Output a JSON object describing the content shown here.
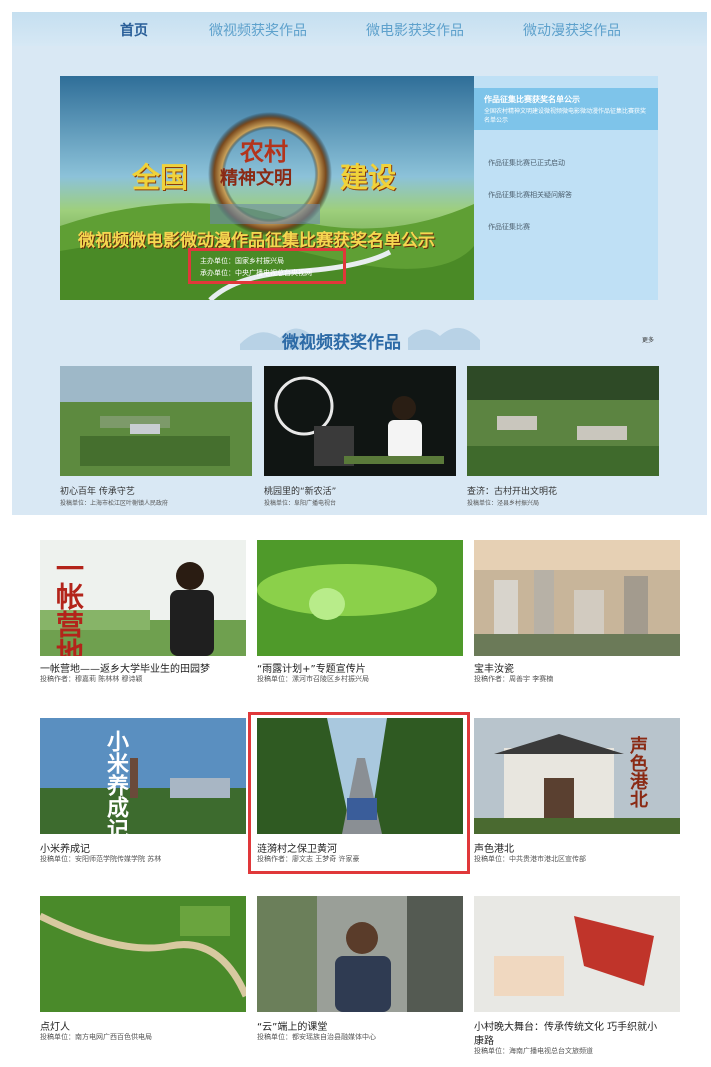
{
  "nav": {
    "items": [
      "首页",
      "微视频获奖作品",
      "微电影获奖作品",
      "微动漫获奖作品"
    ]
  },
  "banner": {
    "title_left": "全国",
    "logo_text_1": "农村",
    "logo_text_2": "精神文明",
    "title_right": "建设",
    "subtitle": "微视频微电影微动漫作品征集比赛获奖名单公示",
    "sponsor": "主办单位：国家乡村振兴局",
    "organizer": "承办单位：中央广播电视总台央视网"
  },
  "news": {
    "items": [
      {
        "title": "作品征集比赛获奖名单公示",
        "desc": "全国农村精神文明建设微视频微电影微动漫作品征集比赛获奖名单公示"
      },
      {
        "title": "作品征集比赛已正式启动"
      },
      {
        "title": "作品征集比赛相关疑问解答"
      },
      {
        "title": "作品征集比赛"
      }
    ]
  },
  "section": {
    "title": "微视频获奖作品",
    "more": "更多"
  },
  "works_top": [
    {
      "title": "初心百年 传承守艺",
      "unit": "投稿单位：上海市松江区叶榭镇人民政府"
    },
    {
      "title": "桃园里的“新农活”",
      "unit": "投稿单位：阜阳广播电视台"
    },
    {
      "title": "查济：古村开出文明花",
      "unit": "投稿单位：泾县乡村振兴局"
    }
  ],
  "works_bottom": [
    {
      "title": "一帐营地——返乡大学毕业生的田园梦",
      "unit": "投稿作者：穆嘉莉 陈林林 穆诗颖",
      "tag": "一帐营地"
    },
    {
      "title": "“雨露计划+”专题宣传片",
      "unit": "投稿单位：漯河市召陵区乡村振兴局"
    },
    {
      "title": "宝丰汝瓷",
      "unit": "投稿作者：周善宇 李赛楠"
    },
    {
      "title": "小米养成记",
      "unit": "投稿单位：安阳师范学院传媒学院 苏林",
      "tag": "小米养成记"
    },
    {
      "title": "涟漪村之保卫黄河",
      "unit": "投稿作者：廖文志 王梦奇 许家豪"
    },
    {
      "title": "声色港北",
      "unit": "投稿单位：中共贵港市港北区宣传部",
      "tag": "声色港北"
    },
    {
      "title": "点灯人",
      "unit": "投稿单位：南方电网广西百色供电局"
    },
    {
      "title": "“云”端上的课堂",
      "unit": "投稿单位：都安瑶族自治县融媒体中心"
    },
    {
      "title": "小村晚大舞台：传承传统文化 巧手织就小",
      "title2": "康路",
      "unit": "投稿单位：海南广播电视总台文旅频道"
    }
  ],
  "colors": {
    "nav_active": "#2a5f99",
    "nav_link": "#5ea1cc",
    "section_title": "#2c6aa6",
    "highlight": "#e0383a",
    "panel_highlight": "#7ec4ea"
  }
}
